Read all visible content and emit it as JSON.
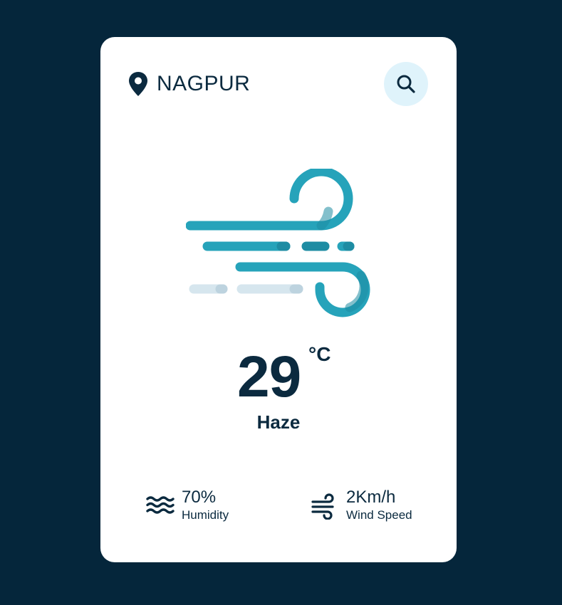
{
  "location": {
    "city": "NAGPUR",
    "icon": "location-pin-icon"
  },
  "search": {
    "icon": "search-icon"
  },
  "weather": {
    "icon": "wind-icon",
    "temperature": "29",
    "unit": "°C",
    "condition": "Haze"
  },
  "stats": {
    "humidity": {
      "icon": "waves-icon",
      "value": "70%",
      "label": "Humidity"
    },
    "wind": {
      "icon": "wind-icon",
      "value": "2Km/h",
      "label": "Wind Speed"
    }
  },
  "colors": {
    "background": "#05263b",
    "card": "#ffffff",
    "text": "#0b2a3f",
    "accent": "#26a3ba",
    "accent_dark": "#1e8ca3",
    "search_bg": "#dff3fb",
    "light_streak": "#d6e6ee"
  }
}
